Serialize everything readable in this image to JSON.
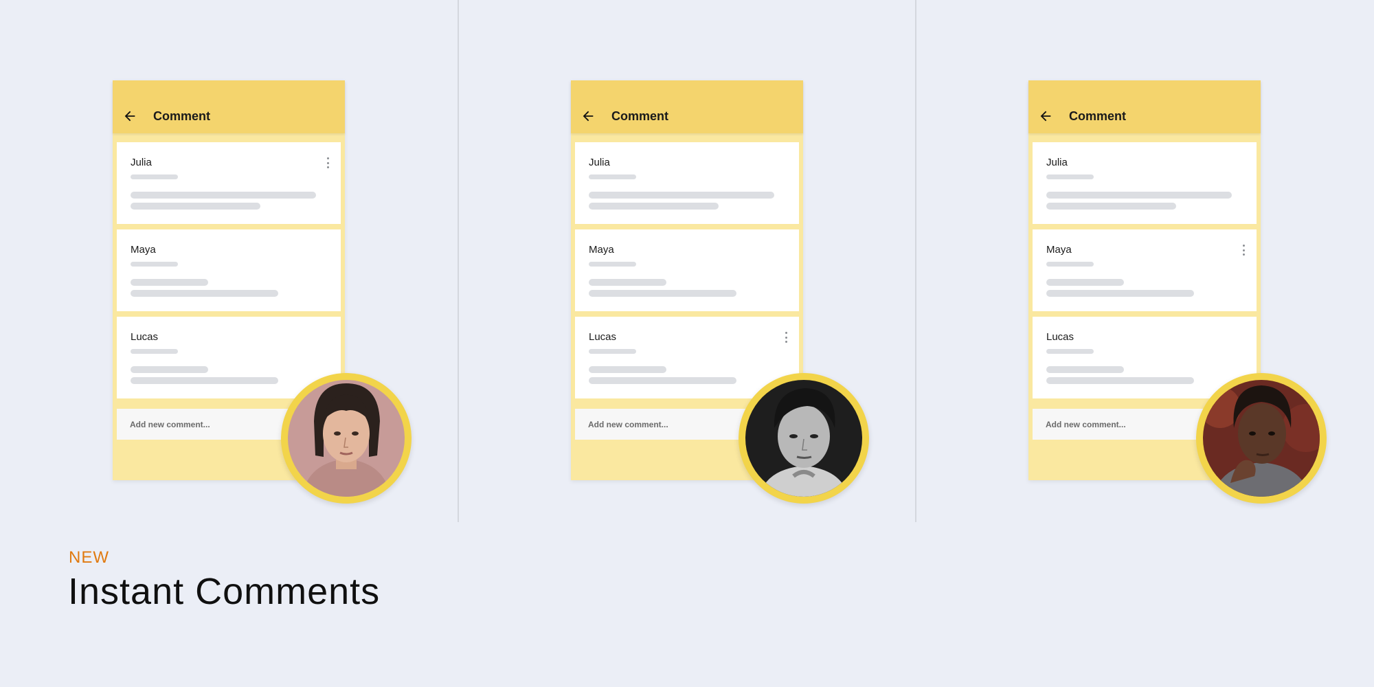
{
  "colors": {
    "background": "#ebeef6",
    "panel": "#fae8a0",
    "header": "#f4d46d",
    "avatar_ring": "#f2d44a",
    "badge": "#e07a10"
  },
  "panels": [
    {
      "header_title": "Comment",
      "back_icon": "arrow-left-icon",
      "comments": [
        {
          "author": "Julia",
          "has_menu": true
        },
        {
          "author": "Maya",
          "has_menu": false
        },
        {
          "author": "Lucas",
          "has_menu": false
        }
      ],
      "input_placeholder": "Add new comment...",
      "avatar": "woman-portrait"
    },
    {
      "header_title": "Comment",
      "back_icon": "arrow-left-icon",
      "comments": [
        {
          "author": "Julia",
          "has_menu": false
        },
        {
          "author": "Maya",
          "has_menu": false
        },
        {
          "author": "Lucas",
          "has_menu": true
        }
      ],
      "input_placeholder": "Add new comment...",
      "avatar": "man-portrait-bw"
    },
    {
      "header_title": "Comment",
      "back_icon": "arrow-left-icon",
      "comments": [
        {
          "author": "Julia",
          "has_menu": false
        },
        {
          "author": "Maya",
          "has_menu": true
        },
        {
          "author": "Lucas",
          "has_menu": false
        }
      ],
      "input_placeholder": "Add new comment...",
      "avatar": "person-portrait"
    }
  ],
  "feature": {
    "badge": "NEW",
    "title": "Instant Comments"
  }
}
